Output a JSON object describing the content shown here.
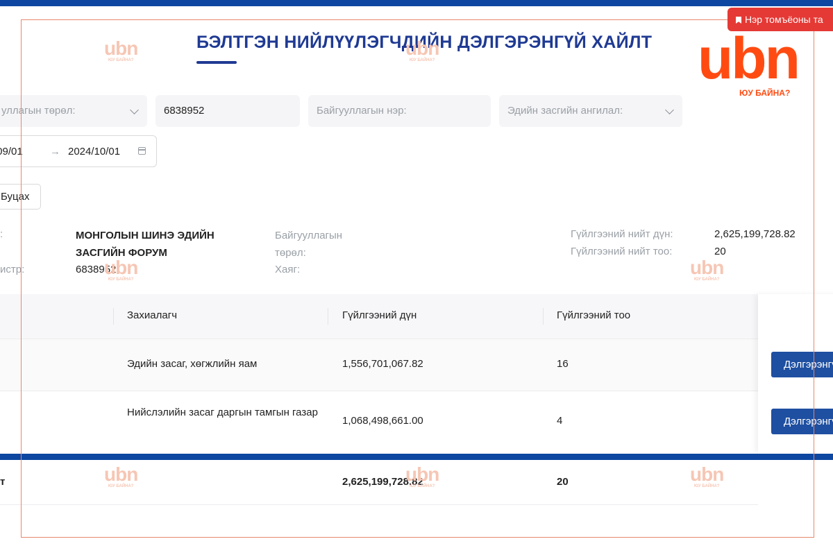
{
  "page": {
    "title": "БЭЛТГЭН НИЙЛҮҮЛЭГЧДИЙН ДЭЛГЭРЭНГҮЙ ХАЙЛТ"
  },
  "badge": {
    "label": "Нэр томъёоны та"
  },
  "logo": {
    "mark": "ubn",
    "tagline": "ЮУ БАЙНА?"
  },
  "watermark": {
    "mark": "ubn",
    "tagline": "ЮУ БАЙНА?"
  },
  "filters": {
    "org_type_placeholder": "уллагын төрөл:",
    "register_value": "6838952",
    "org_name_placeholder": "Байгууллагын нэр:",
    "economic_class_placeholder": "Эдийн засгийн ангилал:",
    "date_from": "/09/01",
    "date_to": "2024/10/01",
    "date_arrow": "→"
  },
  "back_button": {
    "label": "Буцах"
  },
  "info": {
    "label_name": ":",
    "org_name": "МОНГОЛЫН ШИНЭ ЭДИЙН ЗАСГИЙН ФОРУМ",
    "label_register": "истр:",
    "register": "6838952",
    "label_org_type": "Байгууллагын төрөл:",
    "label_address": "Хаяг:",
    "label_total_amount": "Гүйлгээний нийт дүн:",
    "total_amount": "2,625,199,728.82",
    "label_total_count": "Гүйлгээний нийт тоо:",
    "total_count": "20"
  },
  "table": {
    "headers": {
      "customer": "Захиалагч",
      "amount": "Гүйлгээний дүн",
      "count": "Гүйлгээний тоо"
    },
    "rows": [
      {
        "customer": "Эдийн засаг, хөгжлийн яам",
        "amount": "1,556,701,067.82",
        "count": "16",
        "action": "Дэлгэрэнгүй"
      },
      {
        "customer": "Нийслэлийн засаг даргын тамгын газар",
        "amount": "1,068,498,661.00",
        "count": "4",
        "action": "Дэлгэрэнгүй"
      }
    ],
    "total": {
      "label": "т",
      "amount": "2,625,199,728.82",
      "count": "20"
    }
  },
  "colors": {
    "brand_blue": "#1f3a93",
    "bar_blue": "#0d47a1",
    "button_blue": "#1e4fa1",
    "logo_orange": "#ff4b12",
    "badge_red": "#e53935"
  }
}
